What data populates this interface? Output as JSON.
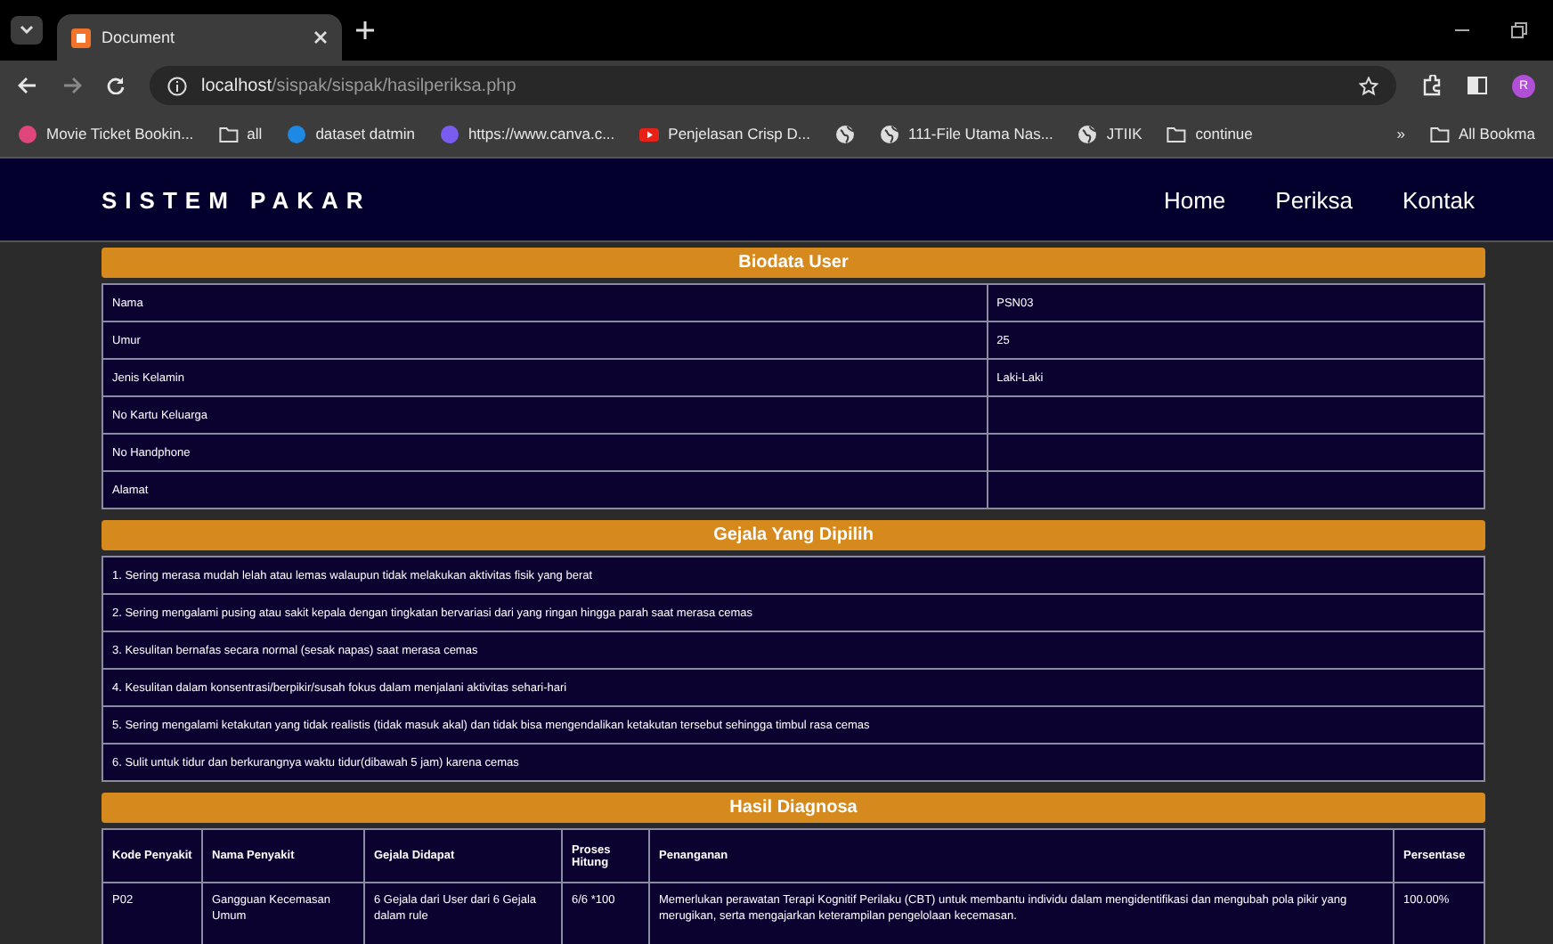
{
  "browser": {
    "tabs": [
      {
        "title": "Document",
        "selected": true
      }
    ],
    "url": {
      "host": "localhost",
      "path": "/sispak/sispak/hasilperiksa.php"
    },
    "bookmarks": [
      {
        "kind": "site",
        "color": "#e0457b",
        "label": "Movie Ticket Bookin..."
      },
      {
        "kind": "folder",
        "label": "all"
      },
      {
        "kind": "site",
        "color": "#1e88e5",
        "label": "dataset datmin"
      },
      {
        "kind": "site",
        "color": "#7b5cf0",
        "label": "https://www.canva.c..."
      },
      {
        "kind": "video",
        "label": "Penjelasan Crisp D..."
      },
      {
        "kind": "globe"
      },
      {
        "kind": "globe",
        "label": "111-File Utama Nas..."
      },
      {
        "kind": "globe",
        "label": "JTIIK"
      },
      {
        "kind": "folder",
        "label": "continue"
      }
    ],
    "overflow": "»",
    "all_bookmarks": "All Bookma",
    "profile": "R"
  },
  "navbar": {
    "brand": "SISTEM PAKAR",
    "links": [
      "Home",
      "Periksa",
      "Kontak"
    ]
  },
  "biodata": {
    "title": "Biodata User",
    "rows": [
      {
        "label": "Nama",
        "value": "PSN03"
      },
      {
        "label": "Umur",
        "value": "25"
      },
      {
        "label": "Jenis Kelamin",
        "value": "Laki-Laki"
      },
      {
        "label": "No Kartu Keluarga"
      },
      {
        "label": "No Handphone"
      },
      {
        "label": "Alamat"
      }
    ]
  },
  "gejala": {
    "title": "Gejala Yang Dipilih",
    "items": [
      "1. Sering merasa mudah lelah atau lemas walaupun tidak melakukan aktivitas fisik yang berat",
      "2. Sering mengalami pusing atau sakit kepala dengan tingkatan bervariasi dari yang ringan hingga parah saat merasa cemas",
      "3. Kesulitan bernafas secara normal (sesak napas) saat merasa cemas",
      "4. Kesulitan dalam konsentrasi/berpikir/susah fokus dalam menjalani aktivitas sehari-hari",
      "5. Sering mengalami ketakutan yang tidak realistis (tidak masuk akal) dan tidak bisa mengendalikan ketakutan tersebut sehingga timbul rasa cemas",
      "6. Sulit untuk tidur dan berkurangnya waktu tidur(dibawah 5 jam) karena cemas"
    ]
  },
  "diagnosa": {
    "title": "Hasil Diagnosa",
    "columns": [
      "Kode Penyakit",
      "Nama Penyakit",
      "Gejala Didapat",
      "Proses Hitung",
      "Penanganan",
      "Persentase"
    ],
    "rows": [
      [
        "P02",
        "Gangguan Kecemasan Umum",
        "6 Gejala dari User dari 6 Gejala dalam rule",
        "6/6 *100",
        "Memerlukan perawatan Terapi Kognitif Perilaku (CBT) untuk membantu individu dalam mengidentifikasi dan mengubah pola pikir yang merugikan, serta mengajarkan keterampilan pengelolaan kecemasan.",
        "100.00%"
      ]
    ]
  }
}
